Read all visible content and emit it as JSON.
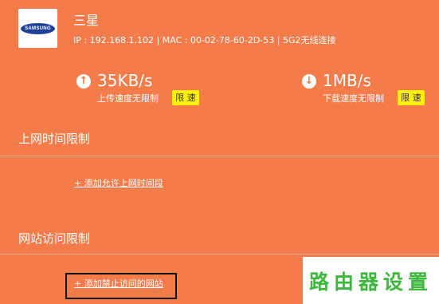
{
  "device": {
    "logo_text": "SAMSUNG",
    "name": "三星",
    "info": "IP : 192.168.1.102 | MAC : 00-02-78-60-2D-53 | 5G2无线连接"
  },
  "upload": {
    "icon": "arrow-up-icon",
    "value": "35KB/s",
    "label": "上传速度无限制",
    "limit_label": "限 速"
  },
  "download": {
    "icon": "arrow-down-icon",
    "value": "1MB/s",
    "label": "下载速度无限制",
    "limit_label": "限 速"
  },
  "time_limit": {
    "title": "上网时间限制",
    "add_link": "+ 添加允许上网时间段"
  },
  "site_limit": {
    "title": "网站访问限制",
    "add_link": "+ 添加禁止访问的网站"
  },
  "watermark": {
    "text": "路由器设置"
  },
  "colors": {
    "background": "#F47C4B",
    "limit_button": "#FFF200",
    "watermark_text": "#3CB83C",
    "samsung_blue": "#1F3F9A"
  }
}
